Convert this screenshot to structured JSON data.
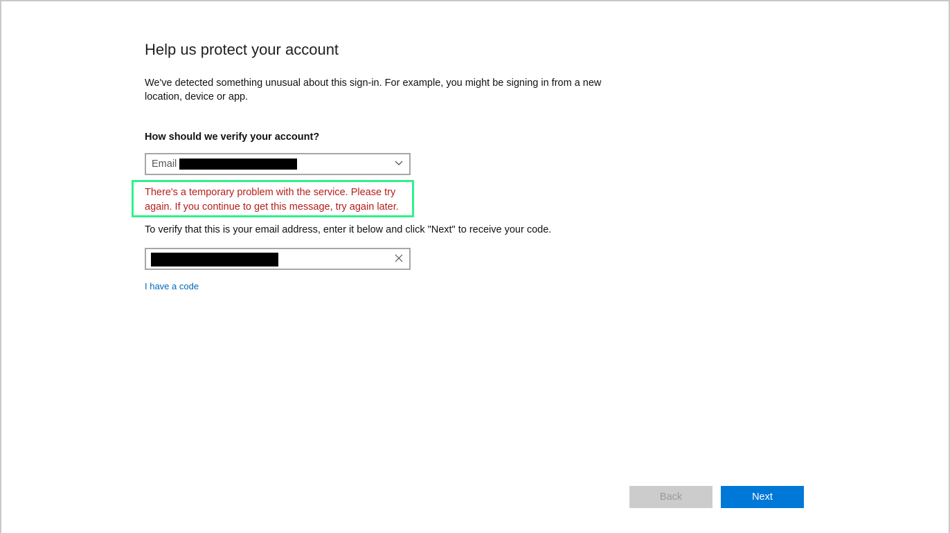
{
  "page": {
    "title": "Help us protect your account",
    "intro": "We've detected something unusual about this sign-in. For example, you might be signing in from a new location, device or app.",
    "question": "How should we verify your account?"
  },
  "verify_method": {
    "selected_label": "Email s",
    "redacted": true
  },
  "error": {
    "message": "There's a temporary problem with the service. Please try again. If you continue to get this message, try again later.",
    "color": "#b71c1c",
    "highlight_color": "#2df28a"
  },
  "email_entry": {
    "instruction": "To verify that this is your email address, enter it below and click \"Next\" to receive your code.",
    "value": "",
    "redacted": true
  },
  "links": {
    "have_code": "I have a code"
  },
  "buttons": {
    "back_label": "Back",
    "next_label": "Next",
    "next_color": "#0078d7",
    "back_disabled": true
  }
}
